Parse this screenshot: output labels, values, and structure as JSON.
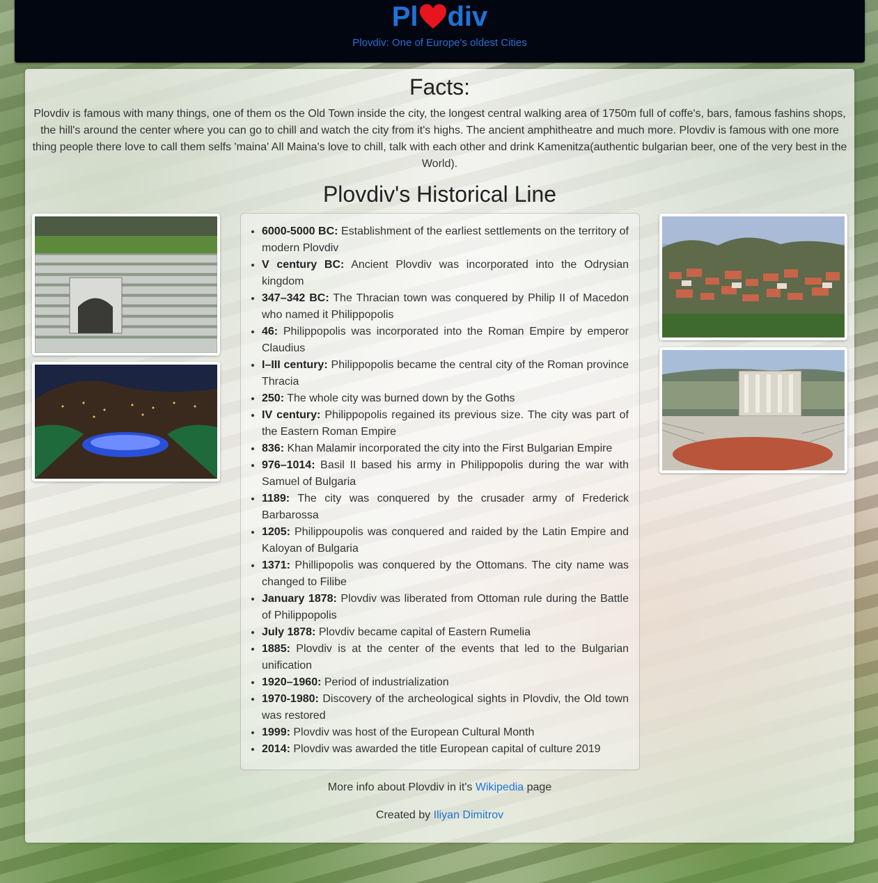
{
  "header": {
    "logo_prefix": "Pl",
    "logo_suffix": "div",
    "logo_icon": "heart-icon",
    "subtitle": "Plovdiv: One of Europe's oldest Cities",
    "colors": {
      "background": "#020611",
      "accent": "#1e73d8",
      "heart": "#e8141e"
    }
  },
  "facts": {
    "title": "Facts:",
    "text": "Plovdiv is famous with many things, one of them os the Old Town inside the city, the longest central walking area of 1750m full of coffe's, bars, famous fashins shops, the hill's around the center where you can go to chill and watch the city from it's highs. The ancient amphitheatre and much more. Plovdiv is famous with one more thing people there love to call them selfs 'maina' All Maina's love to chill, talk with each other and drink Kamenitza(authentic bulgarian beer, one of the very best in the World)."
  },
  "history": {
    "title": "Plovdiv's Historical Line",
    "items": [
      {
        "date": "6000-5000 BC:",
        "text": " Establishment of the earliest settlements on the territory of modern Plovdiv"
      },
      {
        "date": "V century BC:",
        "text": " Ancient Plovdiv was incorporated into the Odrysian kingdom"
      },
      {
        "date": "347–342 BC:",
        "text": " The Thracian town was conquered by Philip II of Macedon who named it Philippopolis"
      },
      {
        "date": "46:",
        "text": " Philippopolis was incorporated into the Roman Empire by emperor Claudius"
      },
      {
        "date": "I–III century:",
        "text": " Philippopolis became the central city of the Roman province Thracia"
      },
      {
        "date": "250:",
        "text": " The whole city was burned down by the Goths"
      },
      {
        "date": "IV century:",
        "text": " Philippopolis regained its previous size. The city was part of the Eastern Roman Empire"
      },
      {
        "date": "836:",
        "text": " Khan Malamir incorporated the city into the First Bulgarian Empire"
      },
      {
        "date": "976–1014:",
        "text": " Basil II based his army in Philippopolis during the war with Samuel of Bulgaria"
      },
      {
        "date": "1189:",
        "text": " The city was conquered by the crusader army of Frederick Barbarossa"
      },
      {
        "date": "1205:",
        "text": " Philippoupolis was conquered and raided by the Latin Empire and Kaloyan of Bulgaria"
      },
      {
        "date": "1371:",
        "text": " Phillipopolis was conquered by the Ottomans. The city name was changed to Filibe"
      },
      {
        "date": "January 1878:",
        "text": " Plovdiv was liberated from Ottoman rule during the Battle of Philippopolis"
      },
      {
        "date": "July 1878:",
        "text": " Plovdiv became capital of Eastern Rumelia"
      },
      {
        "date": "1885:",
        "text": " Plovdiv is at the center of the events that led to the Bulgarian unification"
      },
      {
        "date": "1920–1960:",
        "text": " Period of industrialization"
      },
      {
        "date": "1970-1980:",
        "text": " Discovery of the archeological sights in Plovdiv, the Old town was restored"
      },
      {
        "date": "1999:",
        "text": " Plovdiv was host of the European Cultural Month"
      },
      {
        "date": "2014:",
        "text": " Plovdiv was awarded the title European capital of culture 2019"
      }
    ]
  },
  "footer": {
    "more_info_prefix": "More info about Plovdiv in it's ",
    "more_info_link": "Wikipedia",
    "more_info_suffix": " page",
    "created_by_prefix": "Created by ",
    "created_by_link": "Iliyan Dimitrov"
  }
}
